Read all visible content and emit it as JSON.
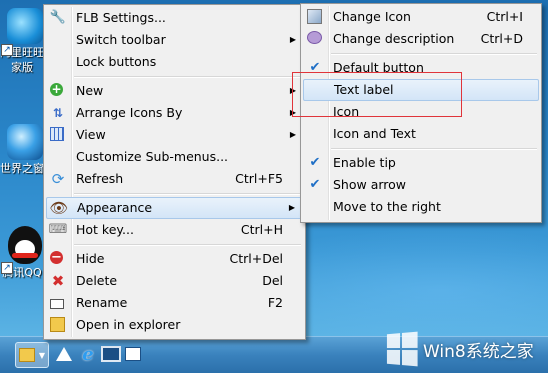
{
  "desktop": {
    "icons": [
      {
        "label_line1": "阿里旺旺",
        "label_line2": "家版",
        "icon": "aliwangwang-icon"
      },
      {
        "label_line1": "世界之窗",
        "label_line2": "",
        "icon": "globe-browser-icon"
      },
      {
        "label_line1": "腾讯QQ",
        "label_line2": "",
        "icon": "qq-penguin-icon"
      }
    ]
  },
  "main_menu": {
    "items": [
      {
        "label": "FLB Settings...",
        "shortcut": "",
        "icon": "wrench-icon"
      },
      {
        "label": "Switch toolbar",
        "shortcut": "",
        "submenu": "▶"
      },
      {
        "label": "Lock buttons",
        "shortcut": ""
      },
      {
        "label": "New",
        "shortcut": "",
        "submenu": "▶",
        "icon": "plus-icon"
      },
      {
        "label": "Arrange Icons By",
        "shortcut": "",
        "submenu": "▶",
        "icon": "arrange-icon"
      },
      {
        "label": "View",
        "shortcut": "",
        "submenu": "▶",
        "icon": "view-icon"
      },
      {
        "label": "Customize Sub-menus...",
        "shortcut": ""
      },
      {
        "label": "Refresh",
        "shortcut": "Ctrl+F5",
        "icon": "refresh-icon"
      },
      {
        "label": "Appearance",
        "shortcut": "",
        "submenu": "▶",
        "icon": "eye-icon"
      },
      {
        "label": "Hot key...",
        "shortcut": "Ctrl+H",
        "icon": "key-icon"
      },
      {
        "label": "Hide",
        "shortcut": "Ctrl+Del",
        "icon": "minus-circle-icon"
      },
      {
        "label": "Delete",
        "shortcut": "Del",
        "icon": "delete-x-icon"
      },
      {
        "label": "Rename",
        "shortcut": "F2",
        "icon": "rename-icon"
      },
      {
        "label": "Open in explorer",
        "shortcut": "",
        "icon": "explorer-folder-icon"
      }
    ]
  },
  "appearance_menu": {
    "items": [
      {
        "label": "Change Icon",
        "shortcut": "Ctrl+I",
        "icon": "change-icon-icon"
      },
      {
        "label": "Change description",
        "shortcut": "Ctrl+D",
        "icon": "description-bubble-icon"
      },
      {
        "label": "Default button",
        "checked": true
      },
      {
        "label": "Text label",
        "checked": false
      },
      {
        "label": "Icon",
        "checked": false
      },
      {
        "label": "Icon and Text",
        "checked": false
      },
      {
        "label": "Enable tip",
        "checked": true
      },
      {
        "label": "Show arrow",
        "checked": true
      },
      {
        "label": "Move to the right",
        "checked": false
      }
    ],
    "check_glyph": "✔"
  },
  "taskbar": {
    "ie_glyph": "e",
    "watermark_text": "Win8系统之家"
  },
  "colors": {
    "highlight": "#d3e5f7",
    "annotation_box": "#e0343a",
    "menu_bg": "#f0f0f0"
  }
}
